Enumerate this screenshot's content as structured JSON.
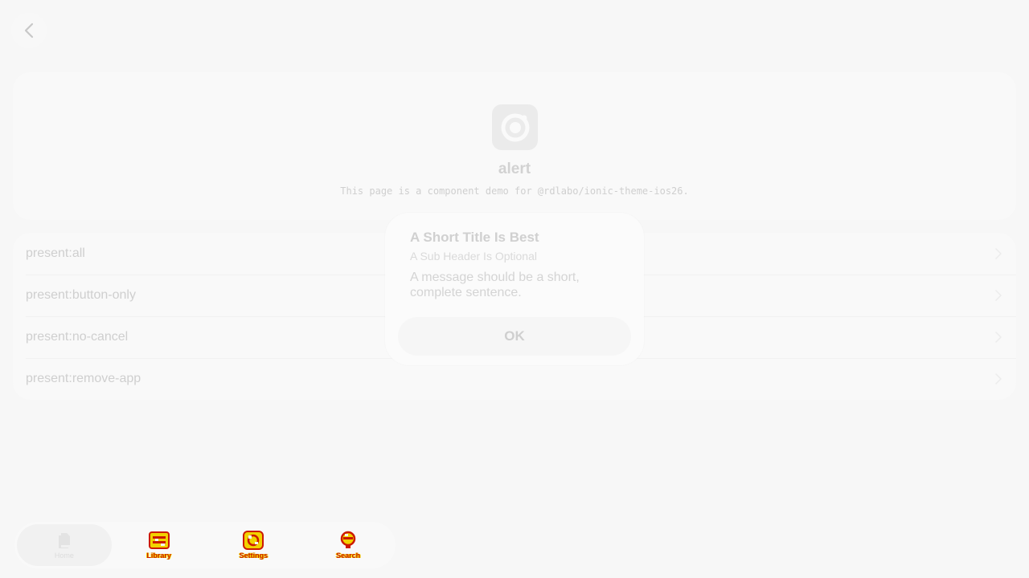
{
  "nav": {
    "back_icon": "chevron-left-icon"
  },
  "header": {
    "logo_icon": "ionic-logo-icon",
    "title": "alert",
    "subtitle": "This page is a component demo for @rdlabo/ionic-theme-ios26."
  },
  "list": {
    "items": [
      {
        "label": "present:all"
      },
      {
        "label": "present:button-only"
      },
      {
        "label": "present:no-cancel"
      },
      {
        "label": "present:remove-app"
      }
    ]
  },
  "alert": {
    "header": "A Short Title Is Best",
    "subheader": "A Sub Header Is Optional",
    "message": "A message should be a short, complete sentence.",
    "button_label": "OK"
  },
  "tabbar": {
    "tabs": [
      {
        "label": "Home",
        "icon": "documents-icon",
        "active": true
      },
      {
        "label": "Library",
        "icon": "library-icon"
      },
      {
        "label": "Settings",
        "icon": "settings-icon"
      },
      {
        "label": "Search",
        "icon": "search-icon"
      }
    ]
  },
  "colors": {
    "background": "#f7f7f7",
    "card": "#f9f9f9",
    "glitch_red": "#cc1a00",
    "glitch_yellow": "#f2d200"
  }
}
